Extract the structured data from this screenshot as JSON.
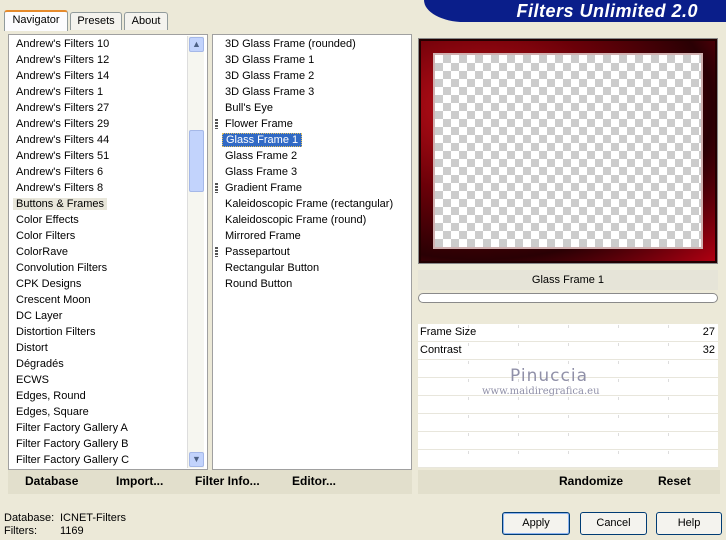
{
  "tabs": [
    {
      "label": "Navigator",
      "active": true
    },
    {
      "label": "Presets",
      "active": false
    },
    {
      "label": "About",
      "active": false
    }
  ],
  "banner_title": "Filters Unlimited 2.0",
  "categories": [
    "Andrew's Filters 10",
    "Andrew's Filters 12",
    "Andrew's Filters 14",
    "Andrew's Filters 1",
    "Andrew's Filters 27",
    "Andrew's Filters 29",
    "Andrew's Filters 44",
    "Andrew's Filters 51",
    "Andrew's Filters 6",
    "Andrew's Filters 8",
    "Buttons & Frames",
    "Color Effects",
    "Color Filters",
    "ColorRave",
    "Convolution Filters",
    "CPK Designs",
    "Crescent Moon",
    "DC Layer",
    "Distortion Filters",
    "Distort",
    "Dégradés",
    "ECWS",
    "Edges, Round",
    "Edges, Square",
    "Filter Factory Gallery A",
    "Filter Factory Gallery B",
    "Filter Factory Gallery C"
  ],
  "selected_category": "Buttons & Frames",
  "filters": [
    {
      "label": "3D Glass Frame (rounded)",
      "grip": false
    },
    {
      "label": "3D Glass Frame 1",
      "grip": false
    },
    {
      "label": "3D Glass Frame 2",
      "grip": false
    },
    {
      "label": "3D Glass Frame 3",
      "grip": false
    },
    {
      "label": "Bull's Eye",
      "grip": false
    },
    {
      "label": "Flower Frame",
      "grip": true
    },
    {
      "label": "Glass Frame 1",
      "grip": false
    },
    {
      "label": "Glass Frame 2",
      "grip": false
    },
    {
      "label": "Glass Frame 3",
      "grip": false
    },
    {
      "label": "Gradient Frame",
      "grip": true
    },
    {
      "label": "Kaleidoscopic Frame (rectangular)",
      "grip": false
    },
    {
      "label": "Kaleidoscopic Frame (round)",
      "grip": false
    },
    {
      "label": "Mirrored Frame",
      "grip": false
    },
    {
      "label": "Passepartout",
      "grip": true
    },
    {
      "label": "Rectangular Button",
      "grip": false
    },
    {
      "label": "Round Button",
      "grip": false
    }
  ],
  "selected_filter": "Glass Frame 1",
  "preview": {
    "filter_name": "Glass Frame 1",
    "frame_color": "#c4101a"
  },
  "params": [
    {
      "label": "Frame Size",
      "value": "27"
    },
    {
      "label": "Contrast",
      "value": "32"
    },
    {
      "label": "",
      "value": ""
    },
    {
      "label": "",
      "value": ""
    },
    {
      "label": "",
      "value": ""
    },
    {
      "label": "",
      "value": ""
    },
    {
      "label": "",
      "value": ""
    },
    {
      "label": "",
      "value": ""
    }
  ],
  "watermark": {
    "line1": "Pinuccia",
    "line2": "www.maidiregrafica.eu"
  },
  "toolbar": {
    "database": "Database",
    "import": "Import...",
    "filter_info": "Filter Info...",
    "editor": "Editor...",
    "randomize": "Randomize",
    "reset": "Reset"
  },
  "status": {
    "database_label": "Database:",
    "database_value": "ICNET-Filters",
    "filters_label": "Filters:",
    "filters_value": "1169"
  },
  "dialog_buttons": {
    "apply": "Apply",
    "cancel": "Cancel",
    "help": "Help"
  }
}
